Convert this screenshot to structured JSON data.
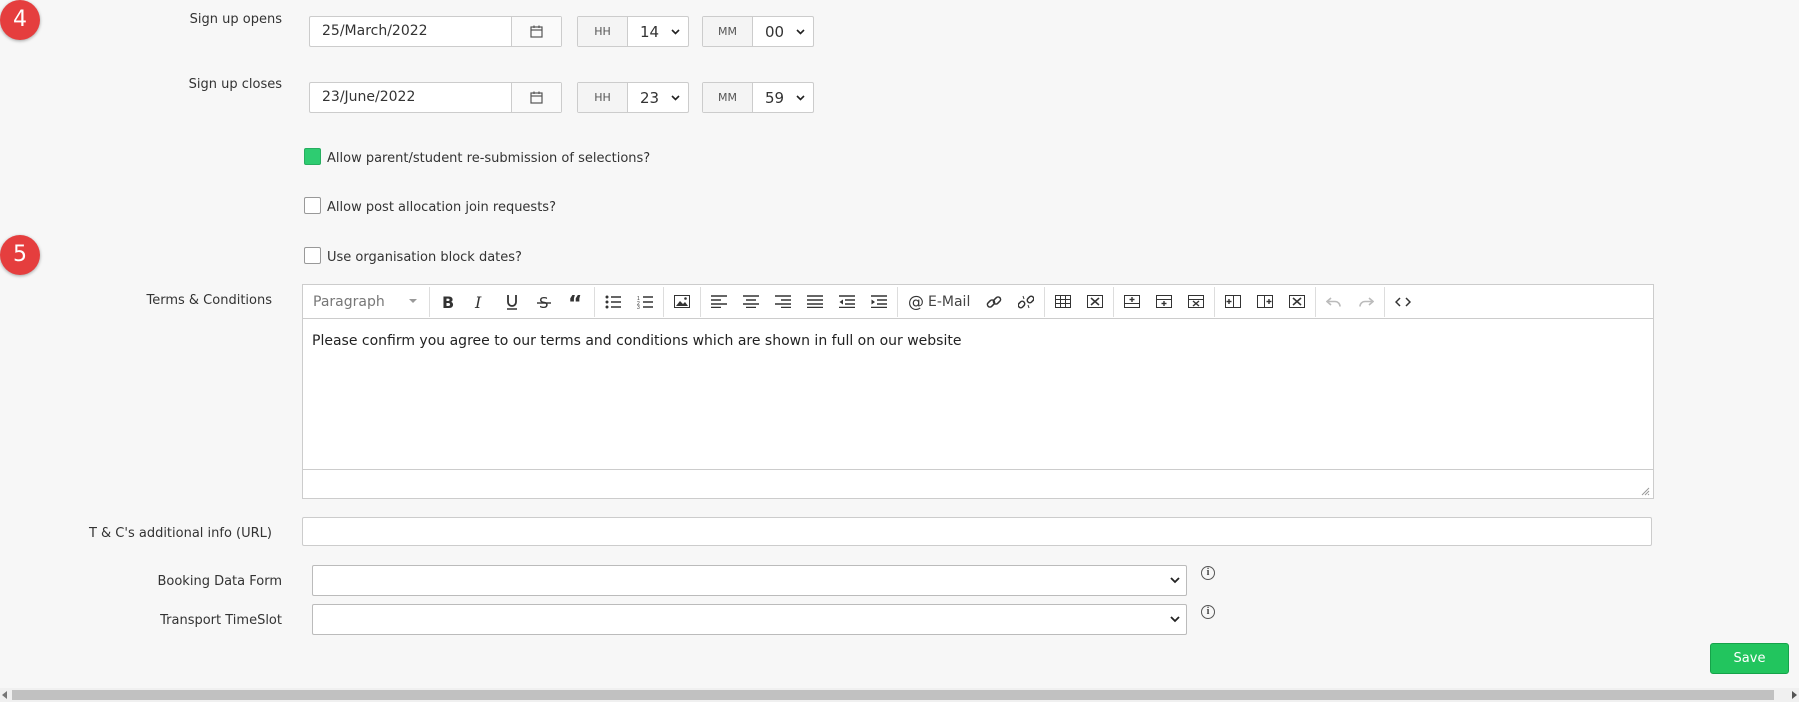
{
  "badges": {
    "step4": "4",
    "step5": "5"
  },
  "signup_opens": {
    "label": "Sign up opens",
    "date": "25/March/2022",
    "hh_label": "HH",
    "hh_value": "14",
    "mm_label": "MM",
    "mm_value": "00"
  },
  "signup_closes": {
    "label": "Sign up closes",
    "date": "23/June/2022",
    "hh_label": "HH",
    "hh_value": "23",
    "mm_label": "MM",
    "mm_value": "59"
  },
  "options": {
    "resubmission": {
      "label": "Allow parent/student re-submission of selections?",
      "checked": true
    },
    "post_allocation": {
      "label": "Allow post allocation join requests?",
      "checked": false
    },
    "block_dates": {
      "label": "Use organisation block dates?",
      "checked": false
    }
  },
  "terms": {
    "label": "Terms & Conditions",
    "format_select": "Paragraph",
    "email_button": "E-Mail",
    "body": "Please confirm you agree to our terms and conditions which are shown in full on our website",
    "toolbar_icons": [
      "bold-icon",
      "italic-icon",
      "underline-icon",
      "strikethrough-icon",
      "blockquote-icon",
      "bullet-list-icon",
      "numbered-list-icon",
      "image-icon",
      "align-left-icon",
      "align-center-icon",
      "align-right-icon",
      "align-justify-icon",
      "outdent-icon",
      "indent-icon",
      "email-icon",
      "link-icon",
      "unlink-icon",
      "table-icon",
      "delete-table-icon",
      "insert-row-before-icon",
      "insert-row-after-icon",
      "delete-row-icon",
      "insert-col-before-icon",
      "insert-col-after-icon",
      "delete-col-icon",
      "undo-icon",
      "redo-icon",
      "source-code-icon"
    ]
  },
  "tc_url": {
    "label": "T & C's additional info (URL)",
    "value": ""
  },
  "booking_form": {
    "label": "Booking Data Form",
    "value": ""
  },
  "transport": {
    "label": "Transport TimeSlot",
    "value": ""
  },
  "save_label": "Save",
  "colors": {
    "badge": "#e53e3e",
    "accent": "#22c55e"
  }
}
